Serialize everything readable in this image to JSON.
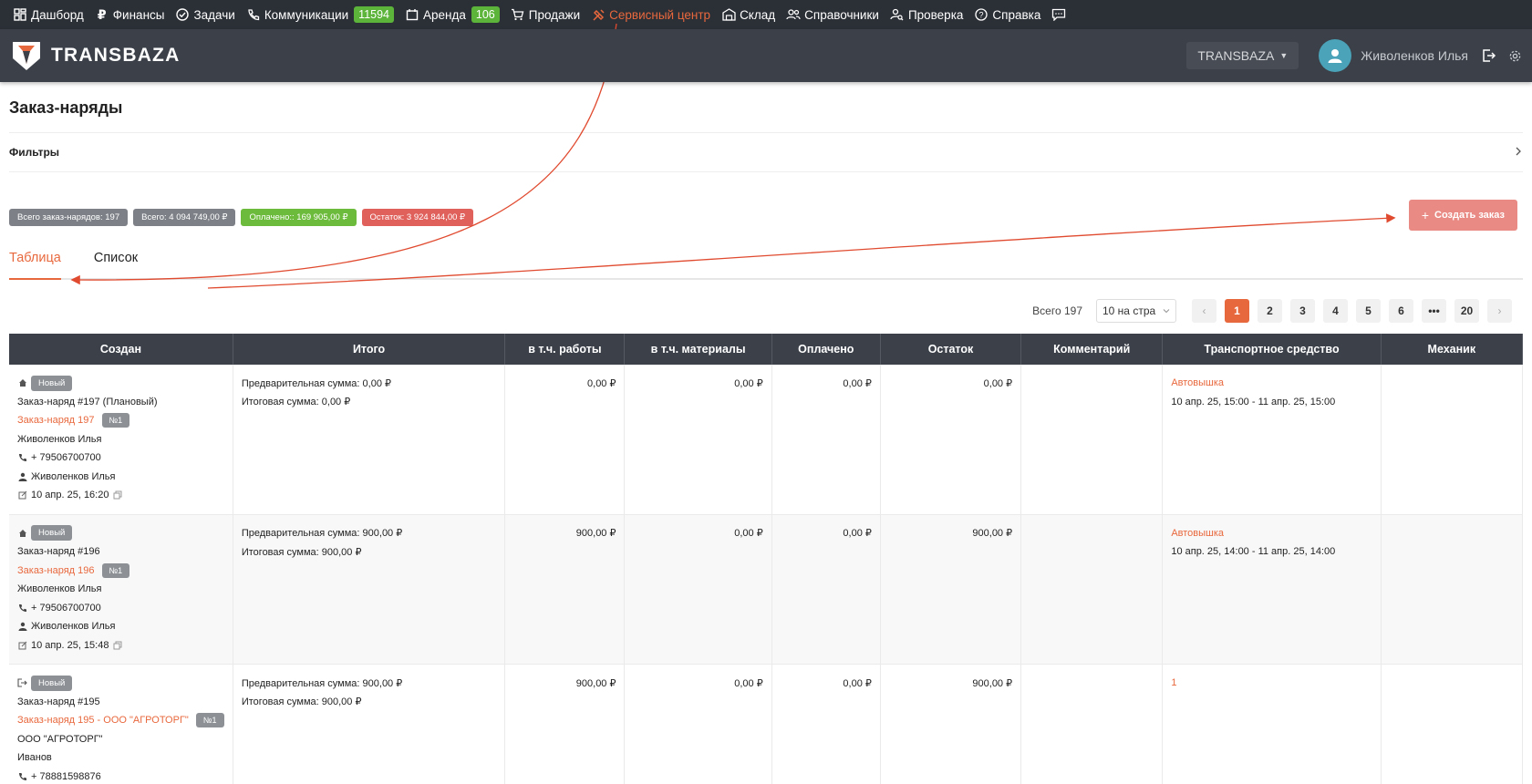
{
  "nav": {
    "items": [
      {
        "label": "Дашборд",
        "icon": "dashboard-icon"
      },
      {
        "label": "Финансы",
        "icon": "ruble-icon"
      },
      {
        "label": "Задачи",
        "icon": "check-circle-icon"
      },
      {
        "label": "Коммуникации",
        "icon": "phone-icon",
        "badge": "11594"
      },
      {
        "label": "Аренда",
        "icon": "calendar-icon",
        "badge": "106"
      },
      {
        "label": "Продажи",
        "icon": "cart-icon"
      },
      {
        "label": "Сервисный центр",
        "icon": "tools-icon",
        "active": true
      },
      {
        "label": "Склад",
        "icon": "warehouse-icon"
      },
      {
        "label": "Справочники",
        "icon": "users-icon"
      },
      {
        "label": "Проверка",
        "icon": "user-search-icon"
      },
      {
        "label": "Справка",
        "icon": "help-icon"
      }
    ]
  },
  "header": {
    "brand": "TRANSBAZA",
    "company": "TRANSBAZA",
    "user": "Живоленков Илья"
  },
  "page": {
    "title": "Заказ-наряды",
    "filters_label": "Фильтры",
    "stats": {
      "total_orders": "Всего заказ-нарядов: 197",
      "total_sum": "Всего: 4 094 749,00 ₽",
      "paid": "Оплачено:: 169 905,00 ₽",
      "remaining": "Остаток: 3 924 844,00 ₽"
    },
    "create_button": "Создать заказ",
    "tabs": [
      "Таблица",
      "Список"
    ]
  },
  "pager": {
    "total": "Всего 197",
    "per_page": "10 на стра",
    "pages": [
      "1",
      "2",
      "3",
      "4",
      "5",
      "6",
      "•••",
      "20"
    ],
    "current": "1"
  },
  "table": {
    "headers": [
      "Создан",
      "Итого",
      "в т.ч. работы",
      "в т.ч. материалы",
      "Оплачено",
      "Остаток",
      "Комментарий",
      "Транспортное средство",
      "Механик"
    ],
    "rows": [
      {
        "status": "Новый",
        "order_name": "Заказ-наряд #197 (Плановый)",
        "order_link": "Заказ-наряд 197",
        "order_num": "№1",
        "client": "Живоленков Илья",
        "phone": "+ 79506700700",
        "manager": "Живоленков Илья",
        "date": "10 апр. 25, 16:20",
        "prelim": "Предварительная сумма: 0,00 ₽",
        "final": "Итоговая сумма: 0,00 ₽",
        "works": "0,00 ₽",
        "materials": "0,00 ₽",
        "paid": "0,00 ₽",
        "remaining": "0,00 ₽",
        "comment": "",
        "vehicle": "Автовышка",
        "period": "10 апр. 25, 15:00 - 11 апр. 25, 15:00",
        "mechanic": ""
      },
      {
        "status": "Новый",
        "order_name": "Заказ-наряд #196",
        "order_link": "Заказ-наряд 196",
        "order_num": "№1",
        "client": "Живоленков Илья",
        "phone": "+ 79506700700",
        "manager": "Живоленков Илья",
        "date": "10 апр. 25, 15:48",
        "prelim": "Предварительная сумма: 900,00 ₽",
        "final": "Итоговая сумма: 900,00 ₽",
        "works": "900,00 ₽",
        "materials": "0,00 ₽",
        "paid": "0,00 ₽",
        "remaining": "900,00 ₽",
        "comment": "",
        "vehicle": "Автовышка",
        "period": "10 апр. 25, 14:00 - 11 апр. 25, 14:00",
        "mechanic": ""
      },
      {
        "status": "Новый",
        "order_name": "Заказ-наряд #195",
        "order_link": "Заказ-наряд 195 - ООО \"АГРОТОРГ\"",
        "order_num": "№1",
        "client": "ООО \"АГРОТОРГ\"",
        "contact": "Иванов",
        "phone": "+ 78881598876",
        "prelim": "Предварительная сумма: 900,00 ₽",
        "final": "Итоговая сумма: 900,00 ₽",
        "works": "900,00 ₽",
        "materials": "0,00 ₽",
        "paid": "0,00 ₽",
        "remaining": "900,00 ₽",
        "comment": "",
        "vehicle": "1",
        "mechanic": ""
      }
    ]
  },
  "colors": {
    "accent": "#e8683d",
    "nav_bg": "#2b2f36",
    "header_bg": "#3b4049",
    "badge_green": "#5cb43a",
    "annotation": "#e04a2f"
  }
}
